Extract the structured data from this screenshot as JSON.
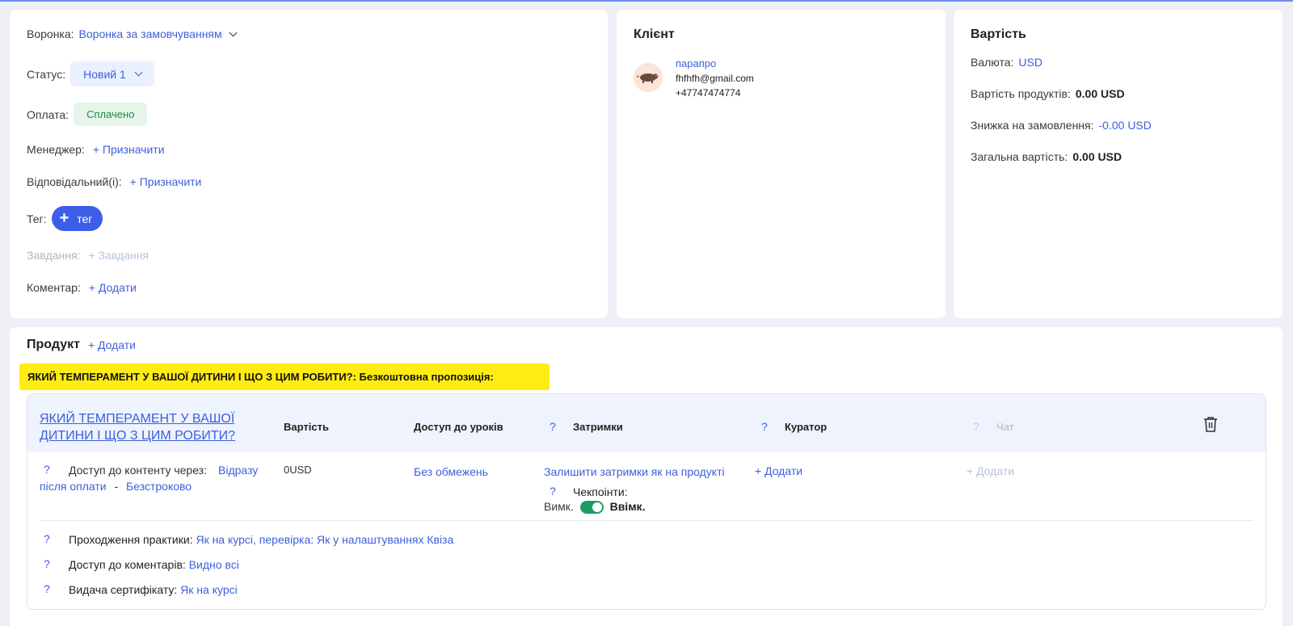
{
  "order": {
    "funnel_label": "Воронка:",
    "funnel_value": "Воронка за замовчуванням",
    "status_label": "Статус:",
    "status_value": "Новий 1",
    "payment_label": "Оплата:",
    "payment_value": "Сплачено",
    "manager_label": "Менеджер:",
    "manager_action": "+ Призначити",
    "responsible_label": "Відповідальний(і):",
    "responsible_action": "+ Призначити",
    "tag_label": "Тег:",
    "tag_button": "тег",
    "tasks_label": "Завдання:",
    "tasks_action": "+ Завдання",
    "comment_label": "Коментар:",
    "comment_action": "+ Додати"
  },
  "client": {
    "title": "Клієнт",
    "name": "парапро",
    "email": "fhfhfh@gmail.com",
    "phone": "+47747474774"
  },
  "cost": {
    "title": "Вартість",
    "currency_label": "Валюта:",
    "currency_value": "USD",
    "products_label": "Вартість продуктів:",
    "products_value": "0.00 USD",
    "discount_label": "Знижка на замовлення:",
    "discount_value": "-0.00 USD",
    "total_label": "Загальна вартість:",
    "total_value": "0.00 USD"
  },
  "product": {
    "title": "Продукт",
    "add_action": "+ Додати",
    "highlight": "ЯКИЙ ТЕМПЕРАМЕНТ У ВАШОЇ ДИТИНИ І ЩО З ЦИМ РОБИТИ?: Безкоштовна пропозиція:",
    "course_title": "ЯКИЙ ТЕМПЕРАМЕНТ У ВАШОЇ ДИТИНИ І ЩО З ЦИМ РОБИТИ?",
    "columns": {
      "price": "Вартість",
      "access": "Доступ до уроків",
      "delays": "Затримки",
      "curator": "Куратор",
      "chat": "Чат"
    },
    "question_mark": "?",
    "content_access_label": "Доступ до контенту через:",
    "content_access_value": "Відразу після оплати",
    "dash": "-",
    "duration_value": "Безстроково",
    "price_value": "0USD",
    "lessons_access_value": "Без обмежень",
    "delays_value": "Залишити затримки як на продукті",
    "checkpoints_label": "Чекпоінти:",
    "toggle_off": "Вимк.",
    "toggle_on": "Ввімк.",
    "toggle_state": true,
    "curator_action": "+ Додати",
    "chat_action": "+ Додати",
    "practice_label": "Проходження практики:",
    "practice_value": "Як на курсі, перевірка: Як у налаштуваннях Квіза",
    "comments_label": "Доступ до коментарів:",
    "comments_value": "Видно всі",
    "certificate_label": "Видача сертифікату:",
    "certificate_value": "Як на курсі"
  }
}
